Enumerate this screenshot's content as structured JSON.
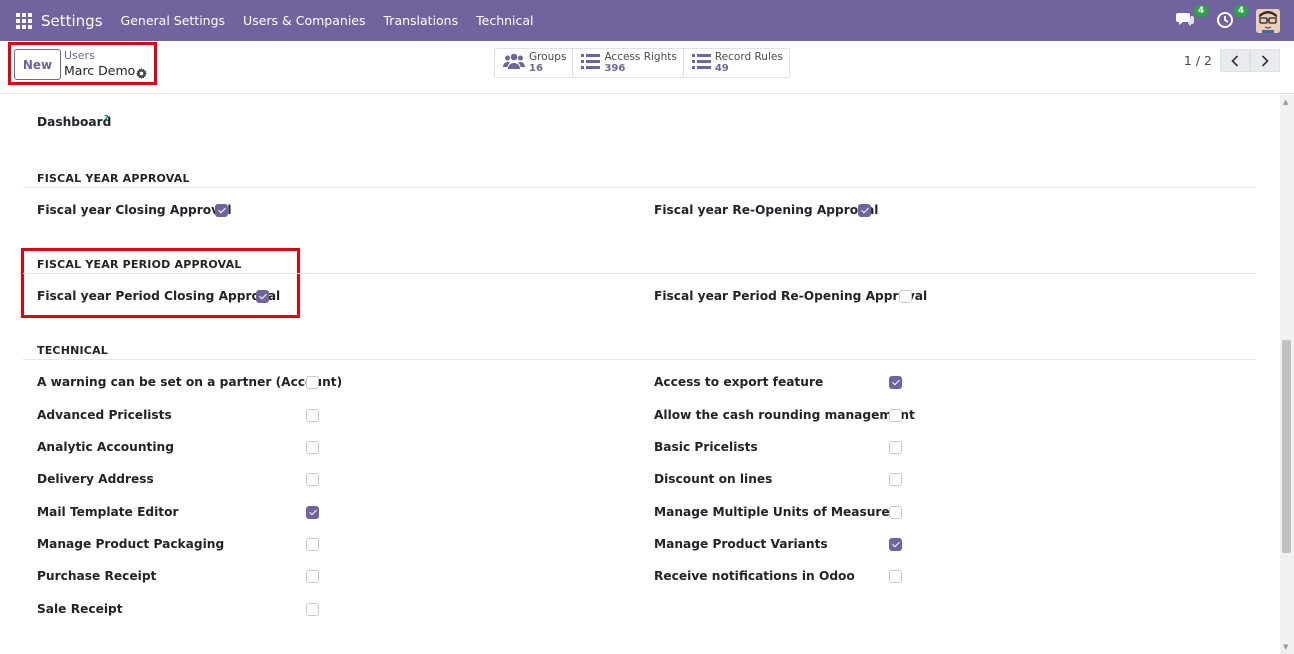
{
  "navbar": {
    "brand": "Settings",
    "menu": [
      "General Settings",
      "Users & Companies",
      "Translations",
      "Technical"
    ],
    "messages_badge": "4",
    "activities_badge": "4"
  },
  "control": {
    "new_label": "New",
    "breadcrumb_parent": "Users",
    "breadcrumb_current": "Marc Demo",
    "smart_buttons": [
      {
        "label": "Groups",
        "value": "16"
      },
      {
        "label": "Access Rights",
        "value": "396"
      },
      {
        "label": "Record Rules",
        "value": "49"
      }
    ],
    "pager": "1 / 2"
  },
  "dashboard_label": "Dashboard",
  "dashboard_help": "?",
  "sections": {
    "fiscal_year": {
      "title": "FISCAL YEAR APPROVAL",
      "left": {
        "label": "Fiscal year Closing Approval",
        "checked": true
      },
      "right": {
        "label": "Fiscal year Re-Opening Approval",
        "checked": true
      }
    },
    "fiscal_period": {
      "title": "FISCAL YEAR PERIOD APPROVAL",
      "left": {
        "label": "Fiscal year Period Closing Approval",
        "checked": true
      },
      "right": {
        "label": "Fiscal year Period Re-Opening Approval",
        "checked": false
      }
    },
    "technical": {
      "title": "TECHNICAL",
      "left": [
        {
          "label": "A warning can be set on a partner (Account)",
          "checked": false
        },
        {
          "label": "Advanced Pricelists",
          "checked": false
        },
        {
          "label": "Analytic Accounting",
          "checked": false
        },
        {
          "label": "Delivery Address",
          "checked": false
        },
        {
          "label": "Mail Template Editor",
          "checked": true
        },
        {
          "label": "Manage Product Packaging",
          "checked": false
        },
        {
          "label": "Purchase Receipt",
          "checked": false
        },
        {
          "label": "Sale Receipt",
          "checked": false
        }
      ],
      "right": [
        {
          "label": "Access to export feature",
          "checked": true
        },
        {
          "label": "Allow the cash rounding management",
          "checked": false
        },
        {
          "label": "Basic Pricelists",
          "checked": false
        },
        {
          "label": "Discount on lines",
          "checked": false
        },
        {
          "label": "Manage Multiple Units of Measure",
          "checked": false
        },
        {
          "label": "Manage Product Variants",
          "checked": true
        },
        {
          "label": "Receive notifications in Odoo",
          "checked": false
        }
      ]
    }
  },
  "colors": {
    "primary": "#71639e",
    "highlight": "#e3000f",
    "badge": "#28a745"
  }
}
